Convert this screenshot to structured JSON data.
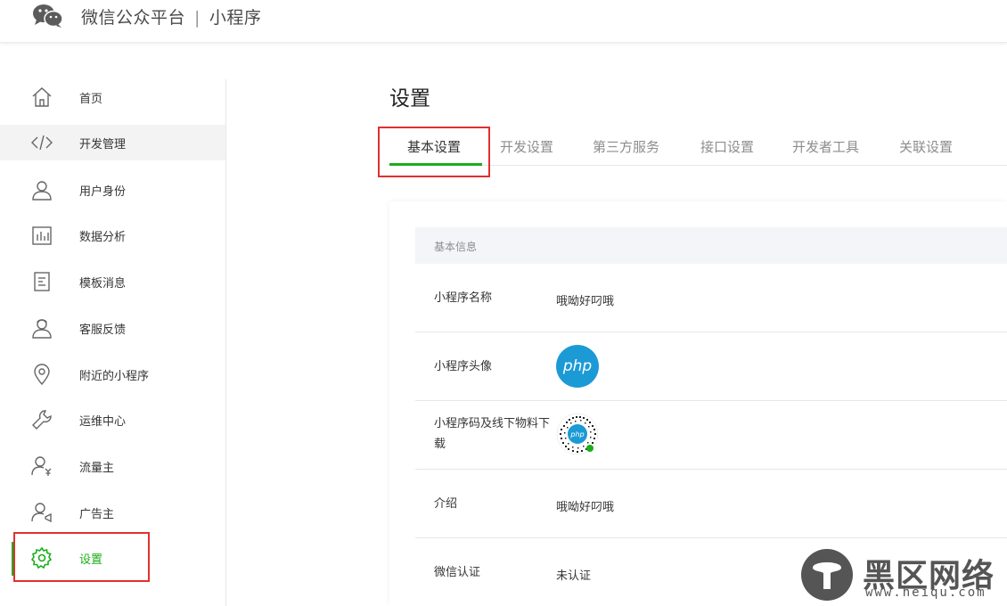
{
  "header": {
    "brand": "微信公众平台",
    "separator": "|",
    "product": "小程序"
  },
  "sidebar": {
    "items": [
      {
        "label": "首页",
        "icon": "home-icon"
      },
      {
        "label": "开发管理",
        "icon": "code-icon"
      },
      {
        "label": "用户身份",
        "icon": "user-icon"
      },
      {
        "label": "数据分析",
        "icon": "bar-chart-icon"
      },
      {
        "label": "模板消息",
        "icon": "document-icon"
      },
      {
        "label": "客服反馈",
        "icon": "customer-service-icon"
      },
      {
        "label": "附近的小程序",
        "icon": "location-icon"
      },
      {
        "label": "运维中心",
        "icon": "wrench-icon"
      },
      {
        "label": "流量主",
        "icon": "user-yen-icon"
      },
      {
        "label": "广告主",
        "icon": "user-megaphone-icon"
      },
      {
        "label": "设置",
        "icon": "gear-icon"
      }
    ],
    "active_index": 10,
    "hover_index": 1,
    "accent_color": "#1aad19"
  },
  "main": {
    "title": "设置",
    "tabs": [
      {
        "label": "基本设置"
      },
      {
        "label": "开发设置"
      },
      {
        "label": "第三方服务"
      },
      {
        "label": "接口设置"
      },
      {
        "label": "开发者工具"
      },
      {
        "label": "关联设置"
      }
    ],
    "active_tab": 0,
    "section": {
      "title": "基本信息",
      "rows": [
        {
          "key": "小程序名称",
          "value": "哦呦好叼哦"
        },
        {
          "key": "小程序头像",
          "value": "php",
          "type": "avatar"
        },
        {
          "key": "小程序码及线下物料下载",
          "value": "php",
          "type": "qrcode"
        },
        {
          "key": "介绍",
          "value": "哦呦好叼哦"
        },
        {
          "key": "微信认证",
          "value": "未认证"
        }
      ]
    }
  },
  "watermark": {
    "text": "黑区网络",
    "url": "www.heiqu.com"
  },
  "colors": {
    "highlight": "#e03030",
    "avatar_bg": "#1c9ad6"
  }
}
